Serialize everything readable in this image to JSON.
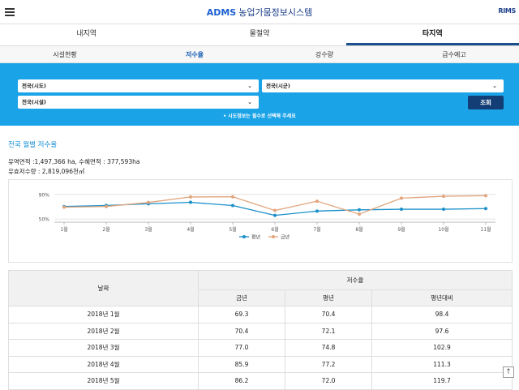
{
  "header": {
    "brand": "ADMS",
    "app_title": "농업가뭄정보시스템",
    "rims_label": "RIMS"
  },
  "tabs_main": [
    {
      "label": "내지역",
      "active": false
    },
    {
      "label": "물절약",
      "active": false
    },
    {
      "label": "타지역",
      "active": true
    }
  ],
  "tabs_sub": [
    {
      "label": "시설현황",
      "active": false
    },
    {
      "label": "저수율",
      "active": true
    },
    {
      "label": "강수량",
      "active": false
    },
    {
      "label": "급수예고",
      "active": false
    }
  ],
  "filters": {
    "sido": "전국(시도)",
    "sigun": "전국(시군)",
    "facility": "전국(시설)",
    "search_button": "조회",
    "notice": "• 시도정보는 필수로 선택해 주세요"
  },
  "section": {
    "title": "전국 월별 저수율",
    "info_line1": "유역면적 :1,497,366 ha, 수혜면적 : 377,593ha",
    "info_line2": "유효저수량 : 2,819,096천㎥"
  },
  "chart_data": {
    "type": "line",
    "categories": [
      "1월",
      "2월",
      "3월",
      "4월",
      "5월",
      "6월",
      "7월",
      "8월",
      "9월",
      "10월",
      "11월"
    ],
    "series": [
      {
        "name": "평년",
        "color": "#1a8fc9",
        "values": [
          70.4,
          72.1,
          74.8,
          77.2,
          72.0,
          56.0,
          63.0,
          65.0,
          66.0,
          66.0,
          67.0
        ]
      },
      {
        "name": "금년",
        "color": "#e0a57d",
        "values": [
          69.3,
          70.4,
          77.0,
          85.9,
          86.2,
          64.0,
          79.0,
          58.0,
          84.0,
          87.0,
          88.0
        ]
      }
    ],
    "ytick_labels": [
      "90%",
      "50%"
    ],
    "yticks": [
      90,
      50
    ],
    "ylim": [
      45,
      95
    ],
    "grid": true,
    "legend_position": "bottom-center"
  },
  "table": {
    "header_date": "날짜",
    "header_group": "저수율",
    "header_cols": [
      "금년",
      "평년",
      "평년대비"
    ],
    "rows": [
      {
        "date": "2018년 1월",
        "this": "69.3",
        "avg": "70.4",
        "ratio": "98.4"
      },
      {
        "date": "2018년 2월",
        "this": "70.4",
        "avg": "72.1",
        "ratio": "97.6"
      },
      {
        "date": "2018년 3월",
        "this": "77.0",
        "avg": "74.8",
        "ratio": "102.9"
      },
      {
        "date": "2018년 4월",
        "this": "85.9",
        "avg": "77.2",
        "ratio": "111.3"
      },
      {
        "date": "2018년 5월",
        "this": "86.2",
        "avg": "72.0",
        "ratio": "119.7"
      }
    ]
  },
  "icons": {
    "menu": "hamburger-icon",
    "dropdown": "chevron-down-icon",
    "scroll_top": "arrow-up-icon"
  }
}
